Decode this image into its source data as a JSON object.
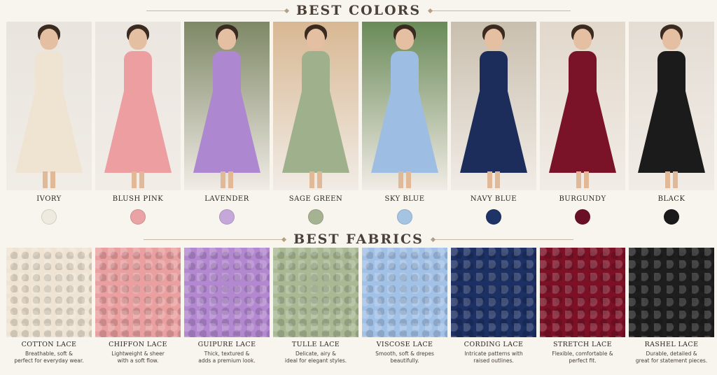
{
  "sections": {
    "colors_title": "BEST COLORS",
    "fabrics_title": "BEST FABRICS"
  },
  "colors": [
    {
      "name": "IVORY",
      "swatch": "#efeae0",
      "dress": "#efe4d2",
      "bg": "#e9e4de"
    },
    {
      "name": "BLUSH PINK",
      "swatch": "#e9a3a5",
      "dress": "#ec9ea1",
      "bg": "#ece6e1"
    },
    {
      "name": "LAVENDER",
      "swatch": "#c5a8d9",
      "dress": "#ad88d0",
      "bg": "#7e8866"
    },
    {
      "name": "SAGE GREEN",
      "swatch": "#a6b392",
      "dress": "#9fb08c",
      "bg": "#d8b893"
    },
    {
      "name": "SKY BLUE",
      "swatch": "#a5c4e3",
      "dress": "#9dbde3",
      "bg": "#6a8a58"
    },
    {
      "name": "NAVY BLUE",
      "swatch": "#1e3366",
      "dress": "#1c2d5c",
      "bg": "#c9bfae"
    },
    {
      "name": "BURGUNDY",
      "swatch": "#6a1025",
      "dress": "#7a1228",
      "bg": "#e2d8cb"
    },
    {
      "name": "BLACK",
      "swatch": "#1a1a1a",
      "dress": "#1b1b1b",
      "bg": "#e4ddd4"
    }
  ],
  "fabrics": [
    {
      "name": "COTTON LACE",
      "desc1": "Breathable, soft &",
      "desc2": "perfect for everyday wear.",
      "color": "#efe4d3"
    },
    {
      "name": "CHIFFON LACE",
      "desc1": "Lightweight & sheer",
      "desc2": "with a soft flow.",
      "color": "#eaa0a0"
    },
    {
      "name": "GUIPURE LACE",
      "desc1": "Thick, textured &",
      "desc2": "adds a premium look.",
      "color": "#b388d0"
    },
    {
      "name": "TULLE LACE",
      "desc1": "Delicate, airy &",
      "desc2": "ideal for elegant styles.",
      "color": "#a8b994"
    },
    {
      "name": "VISCOSE LACE",
      "desc1": "Smooth, soft & drepes",
      "desc2": "beautifully.",
      "color": "#a2c1e6"
    },
    {
      "name": "CORDING LACE",
      "desc1": "Intricate patterns with",
      "desc2": "raised outlines.",
      "color": "#1d3064"
    },
    {
      "name": "STRETCH LACE",
      "desc1": "Flexible, comfortable &",
      "desc2": "perfect fit.",
      "color": "#7c1126"
    },
    {
      "name": "RASHEL LACE",
      "desc1": "Durable, detailed &",
      "desc2": "great for statement pieces.",
      "color": "#1e1e1e"
    }
  ]
}
